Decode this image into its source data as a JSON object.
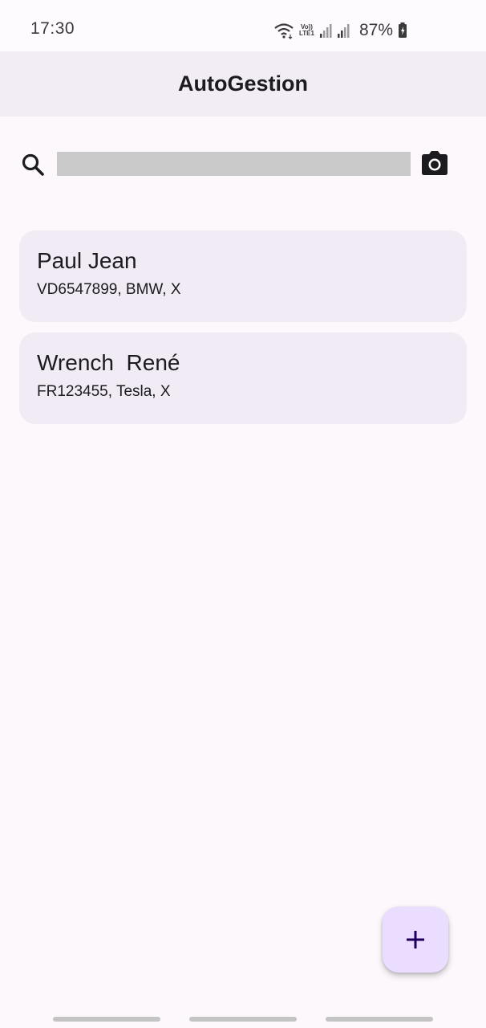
{
  "status_bar": {
    "time": "17:30",
    "volte_top": "Vo))",
    "volte_bottom": "LTE1",
    "battery": "87%",
    "icons": [
      "wifi-icon",
      "volte-icon",
      "signal-icon",
      "signal-icon",
      "battery-charging-icon"
    ]
  },
  "app_bar": {
    "title": "AutoGestion"
  },
  "search": {
    "value": "",
    "placeholder": "",
    "icon": "search-icon",
    "camera_icon": "camera-icon"
  },
  "clients": [
    {
      "name": "Paul Jean",
      "detail": "VD6547899, BMW, X"
    },
    {
      "name": "Wrench  René",
      "detail": "FR123455, Tesla, X"
    }
  ],
  "fab": {
    "icon": "add-icon",
    "label": "+"
  },
  "colors": {
    "background": "#fcf8fc",
    "app_bar": "#f2ecf5",
    "card": "#f1ebf5",
    "search_field": "#cacaca",
    "fab": "#eaddff",
    "fab_icon": "#21005d"
  }
}
